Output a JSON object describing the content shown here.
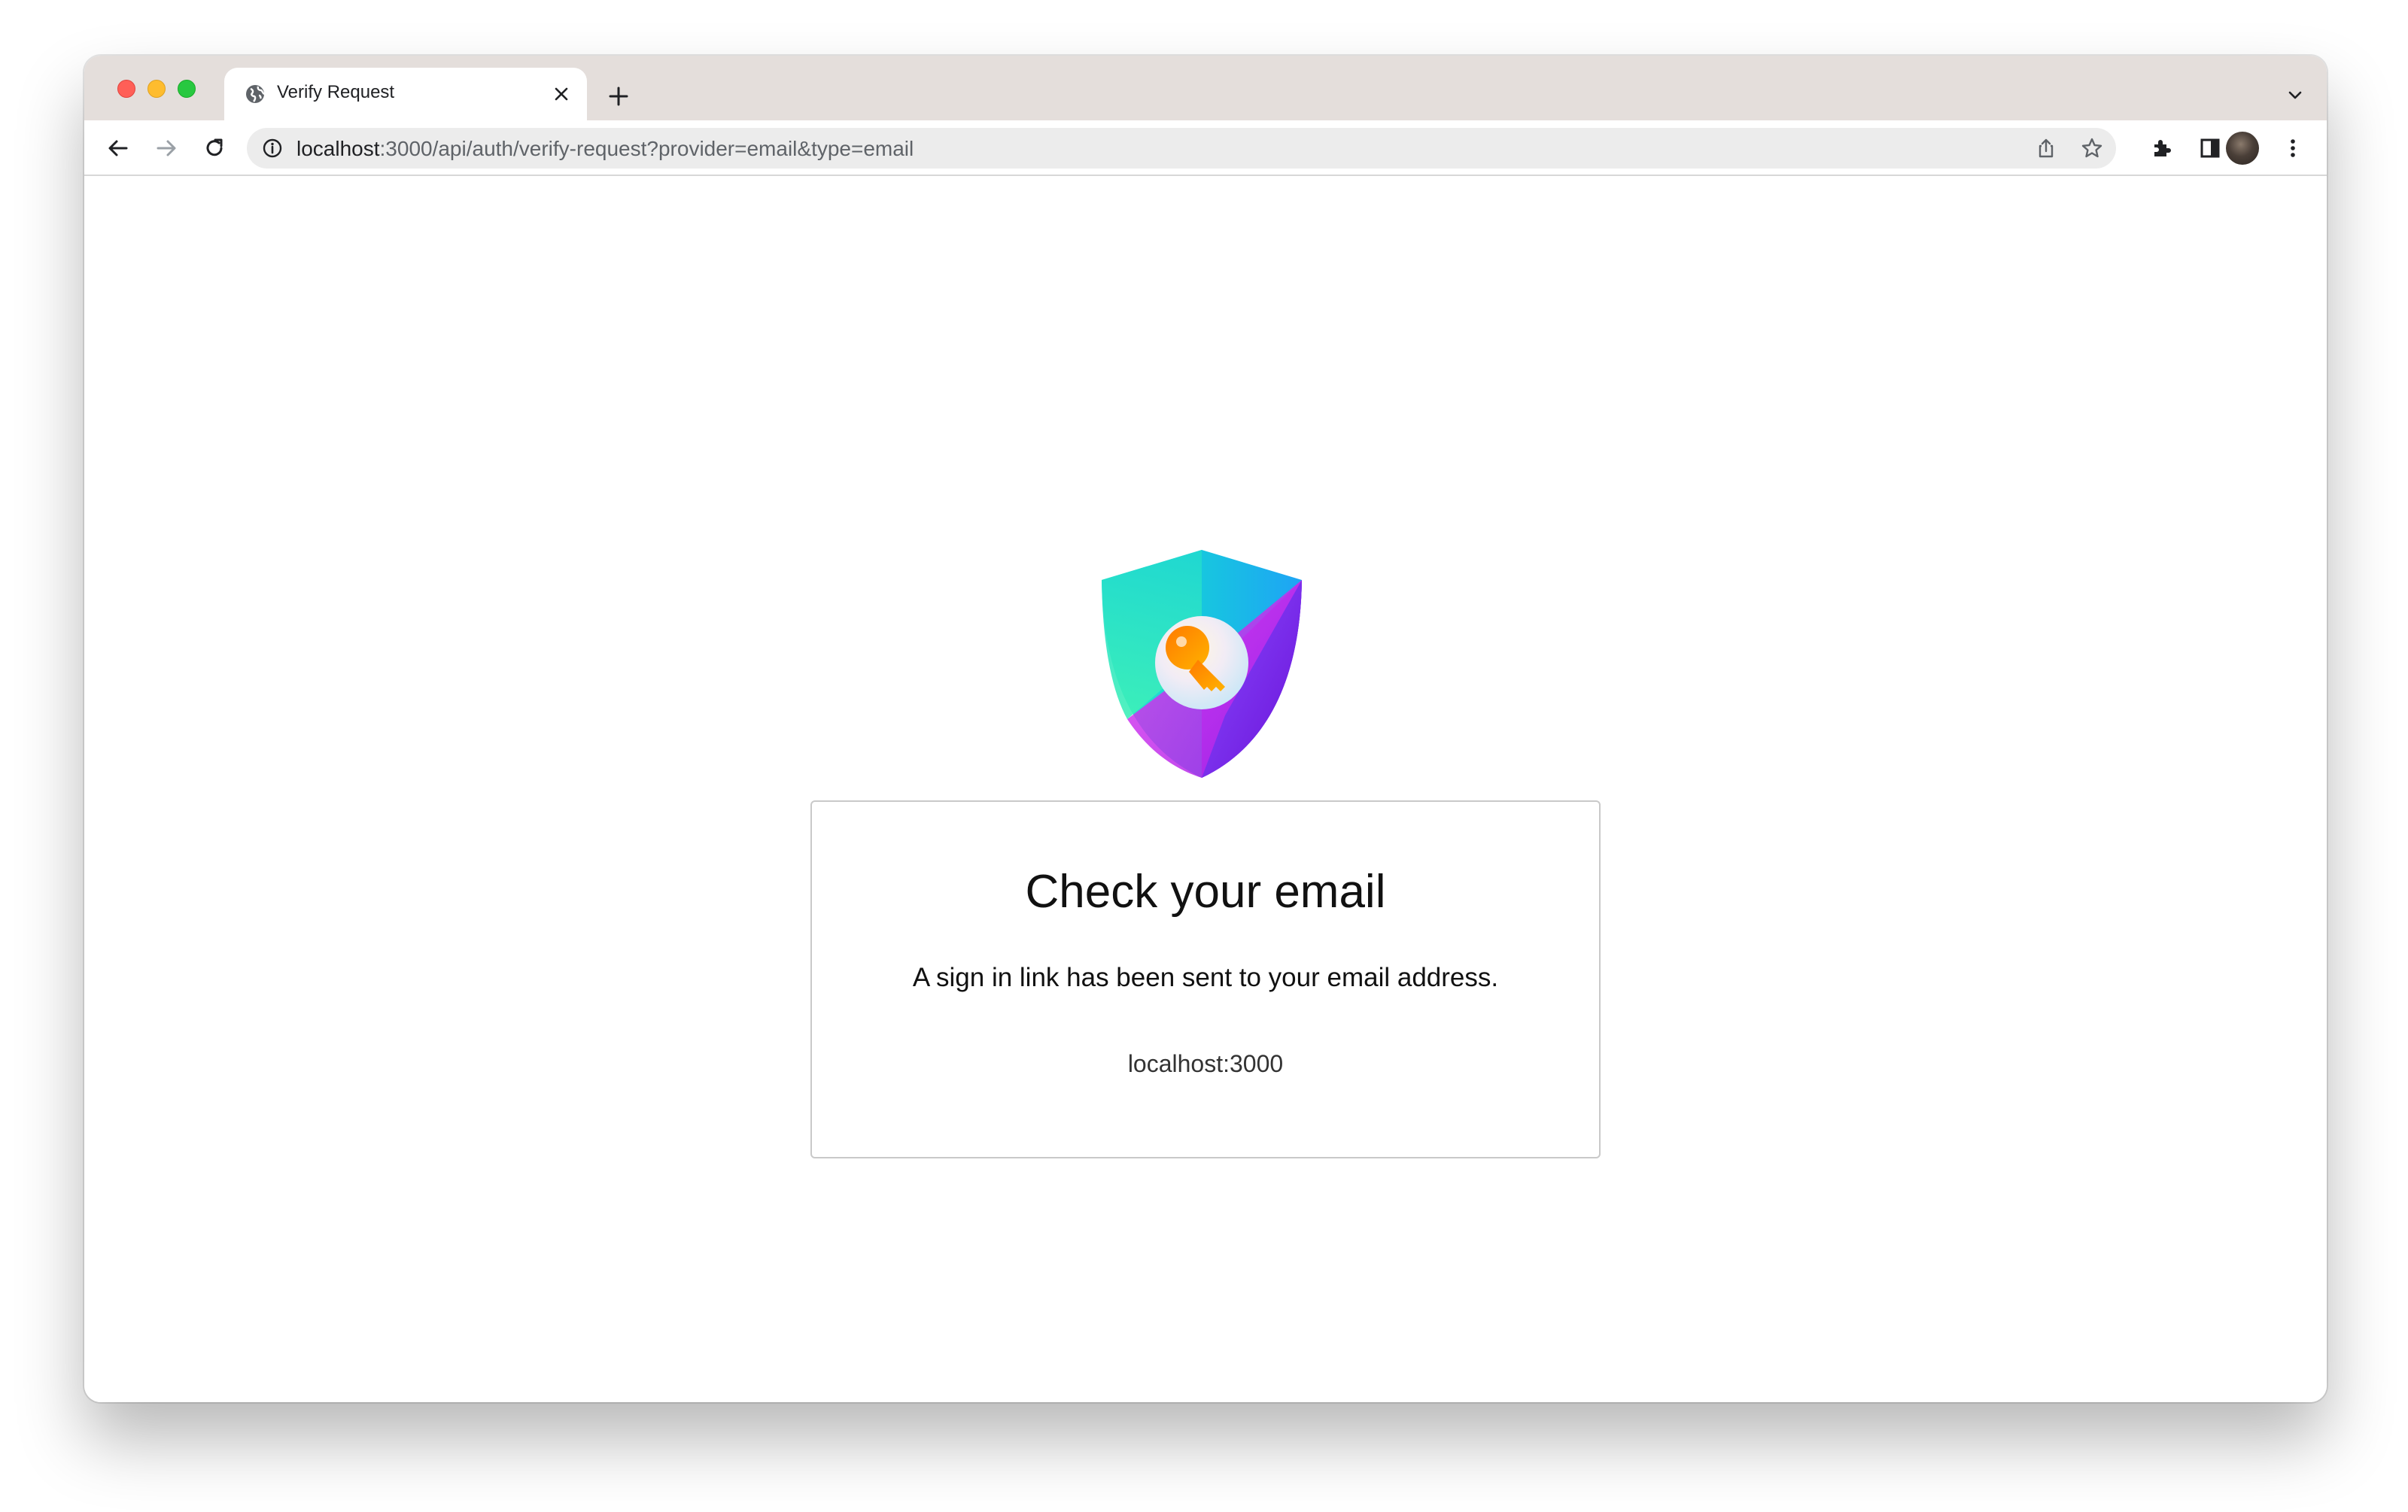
{
  "browser": {
    "tab": {
      "title": "Verify Request",
      "favicon_icon": "globe-icon",
      "close_icon": "close-icon"
    },
    "new_tab_icon": "plus-icon",
    "tab_search_icon": "chevron-down-icon",
    "toolbar": {
      "back_icon": "arrow-left-icon",
      "forward_icon": "arrow-right-icon",
      "reload_icon": "reload-icon",
      "extensions_icon": "puzzle-icon",
      "side_panel_icon": "side-panel-icon",
      "menu_icon": "kebab-menu-icon"
    },
    "address_bar": {
      "host": "localhost",
      "rest": ":3000/api/auth/verify-request?provider=email&type=email",
      "info_icon": "info-icon",
      "share_icon": "share-icon",
      "bookmark_icon": "star-icon"
    },
    "colors": {
      "traffic_red": "#ff5f57",
      "traffic_yellow": "#febc2e",
      "traffic_green": "#28c840",
      "tabstrip": "#e4dedb"
    }
  },
  "page": {
    "logo_icon": "shield-key-icon",
    "card": {
      "title": "Check your email",
      "message": "A sign in link has been sent to your email address.",
      "host": "localhost:3000"
    }
  }
}
